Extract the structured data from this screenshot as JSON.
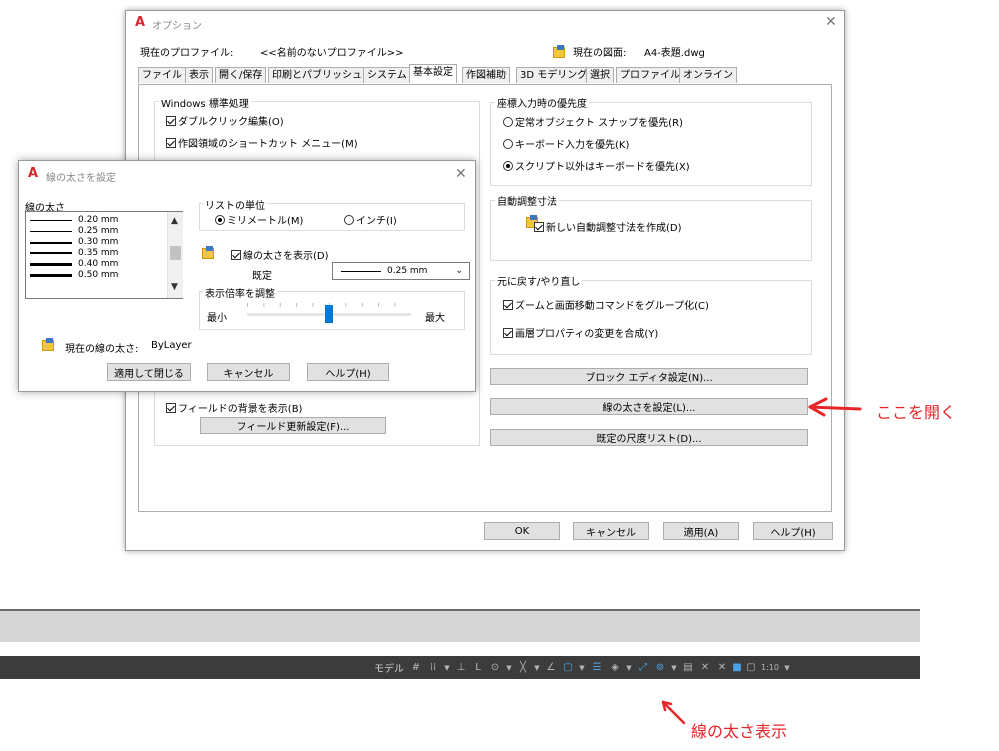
{
  "options_dialog": {
    "title": "オプション",
    "profile_label": "現在のプロファイル:",
    "profile_value": "<<名前のないプロファイル>>",
    "drawing_label": "現在の図面:",
    "drawing_value": "A4-表題.dwg",
    "tabs": [
      "ファイル",
      "表示",
      "開く/保存",
      "印刷とパブリッシュ",
      "システム",
      "基本設定",
      "作図補助",
      "3D モデリング",
      "選択",
      "プロファイル",
      "オンライン"
    ],
    "active_tab": "基本設定",
    "windows_group": {
      "label": "Windows 標準処理",
      "dblclick": "ダブルクリック編集(O)",
      "shortcut": "作図領域のショートカット メニュー(M)"
    },
    "field_bg": "フィールドの背景を表示(B)",
    "field_update_btn": "フィールド更新設定(F)...",
    "coord_group": {
      "label": "座標入力時の優先度",
      "opt1": "定常オブジェクト スナップを優先(R)",
      "opt2": "キーボード入力を優先(K)",
      "opt3": "スクリプト以外はキーボードを優先(X)"
    },
    "assoc_group": {
      "label": "自動調整寸法",
      "check": "新しい自動調整寸法を作成(D)"
    },
    "undo_group": {
      "label": "元に戻す/やり直し",
      "zoom": "ズームと画面移動コマンドをグループ化(C)",
      "layer": "画層プロパティの変更を合成(Y)"
    },
    "block_editor_btn": "ブロック エディタ設定(N)...",
    "lineweight_btn": "線の太さを設定(L)...",
    "scale_list_btn": "既定の尺度リスト(D)...",
    "ok": "OK",
    "cancel": "キャンセル",
    "apply": "適用(A)",
    "help": "ヘルプ(H)"
  },
  "lw_dialog": {
    "title": "線の太さを設定",
    "list_label": "線の太さ",
    "items": [
      "0.20 mm",
      "0.25 mm",
      "0.30 mm",
      "0.35 mm",
      "0.40 mm",
      "0.50 mm"
    ],
    "units_label": "リストの単位",
    "unit_mm": "ミリメートル(M)",
    "unit_inch": "インチ(I)",
    "display_check": "線の太さを表示(D)",
    "default_label": "既定",
    "default_value": "0.25 mm",
    "scale_label": "表示倍率を調整",
    "min": "最小",
    "max": "最大",
    "slider_level": 0.5,
    "current_label": "現在の線の太さ:",
    "current_value": "ByLayer",
    "apply_close": "適用して閉じる",
    "cancel": "キャンセル",
    "help": "ヘルプ(H)"
  },
  "annotations": {
    "open_here": "ここを開く",
    "lw_display": "線の太さ表示"
  },
  "statusbar": {
    "model": "モデル",
    "scale": "1:10"
  },
  "colors": {
    "annotation_red": "#e8262a",
    "autocad_red": "#d9272e",
    "statusbar_dark": "#3c3c3c",
    "statusbar_blue": "#4aa3e8"
  }
}
